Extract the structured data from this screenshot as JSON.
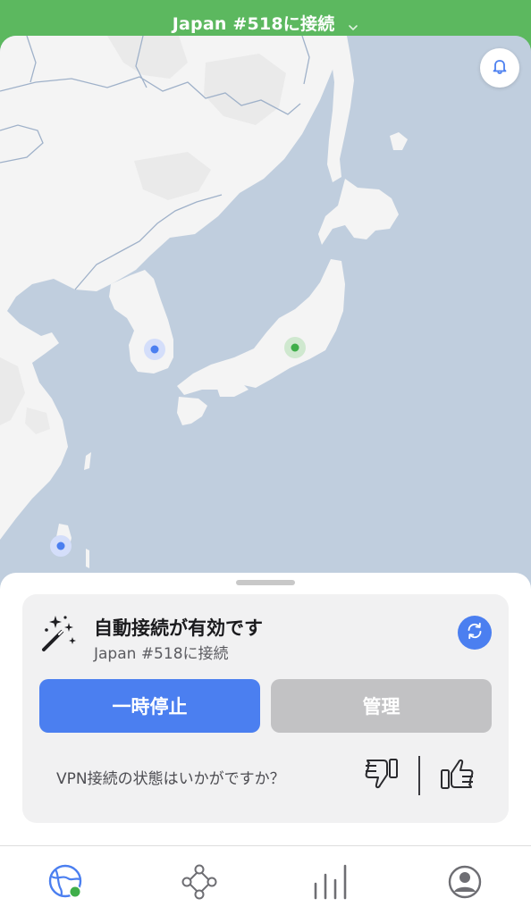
{
  "header": {
    "title": "Japan #518に接続"
  },
  "map": {
    "icons": {
      "notifications": "bell-icon"
    },
    "markers": [
      {
        "name": "korea-server",
        "status": "available",
        "color": "#4b7ff0"
      },
      {
        "name": "japan-server",
        "status": "connected",
        "color": "#3fae4a"
      },
      {
        "name": "taiwan-server",
        "status": "available",
        "color": "#4b7ff0"
      }
    ],
    "colors": {
      "sea": "#c0cede",
      "land": "#f3f3f3"
    }
  },
  "panel": {
    "title": "自動接続が有効です",
    "subtitle": "Japan #518に接続",
    "pause_label": "一時停止",
    "manage_label": "管理",
    "feedback_question": "VPN接続の状態はいかがですか？"
  },
  "nav": {
    "items": [
      {
        "name": "map",
        "icon": "globe-icon",
        "active": true
      },
      {
        "name": "meshnet",
        "icon": "meshnet-icon",
        "active": false
      },
      {
        "name": "stats",
        "icon": "stats-bars-icon",
        "active": false
      },
      {
        "name": "profile",
        "icon": "profile-icon",
        "active": false
      }
    ]
  },
  "colors": {
    "accent": "#4b7ff0",
    "connected": "#5cb85f",
    "disabled_button": "#c2c2c4"
  }
}
